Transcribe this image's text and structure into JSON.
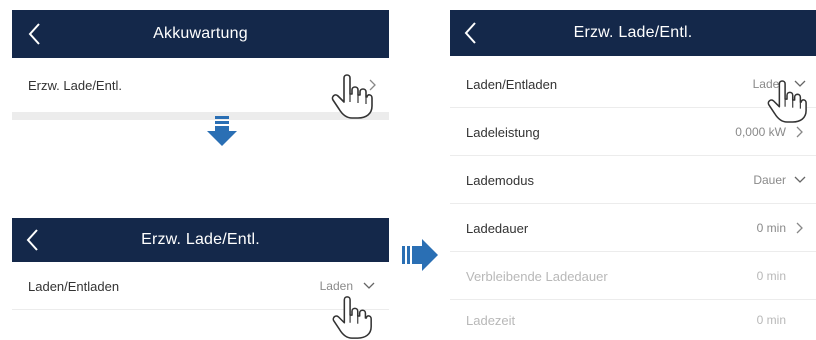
{
  "screen1": {
    "title": "Akkuwartung",
    "row_label": "Erzw. Lade/Entl."
  },
  "screen2": {
    "title": "Erzw. Lade/Entl.",
    "row_label": "Laden/Entladen",
    "row_value": "Laden"
  },
  "screen3": {
    "title": "Erzw. Lade/Entl.",
    "rows": [
      {
        "label": "Laden/Entladen",
        "value": "Laden",
        "chevron": "chevron-down-icon"
      },
      {
        "label": "Ladeleistung",
        "value": "0,000 kW",
        "chevron": "chevron-right-icon"
      },
      {
        "label": "Lademodus",
        "value": "Dauer",
        "chevron": "chevron-down-icon"
      },
      {
        "label": "Ladedauer",
        "value": "0 min",
        "chevron": "chevron-right-icon"
      },
      {
        "label": "Verbleibende Ladedauer",
        "value": "0 min",
        "chevron": ""
      },
      {
        "label": "Ladezeit",
        "value": "0 min",
        "chevron": ""
      }
    ]
  },
  "colors": {
    "appbar": "#14284a",
    "arrow": "#2a6fb4"
  }
}
